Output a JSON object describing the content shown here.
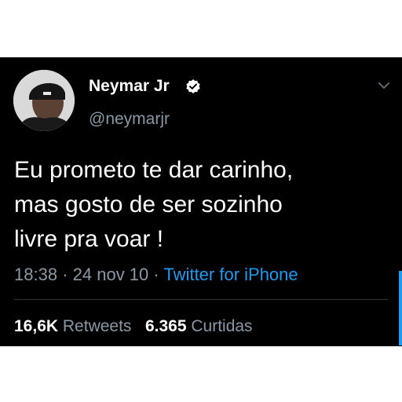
{
  "tweet": {
    "author_name": "Neymar Jr",
    "author_handle": "@neymarjr",
    "text_lines": [
      "Eu prometo te dar carinho,",
      "mas gosto de ser sozinho",
      "livre pra voar !"
    ],
    "time": "18:38",
    "date": "24 nov 10",
    "separator": "·",
    "source": "Twitter for iPhone",
    "retweets_count": "16,6K",
    "retweets_label": "Retweets",
    "likes_count": "6.365",
    "likes_label": "Curtidas"
  },
  "icons": {
    "verified": "verified-badge-icon",
    "chevron": "chevron-down-icon"
  },
  "colors": {
    "background": "#000000",
    "text": "#ffffff",
    "muted": "#8b98a5",
    "link": "#1d9bf0"
  }
}
